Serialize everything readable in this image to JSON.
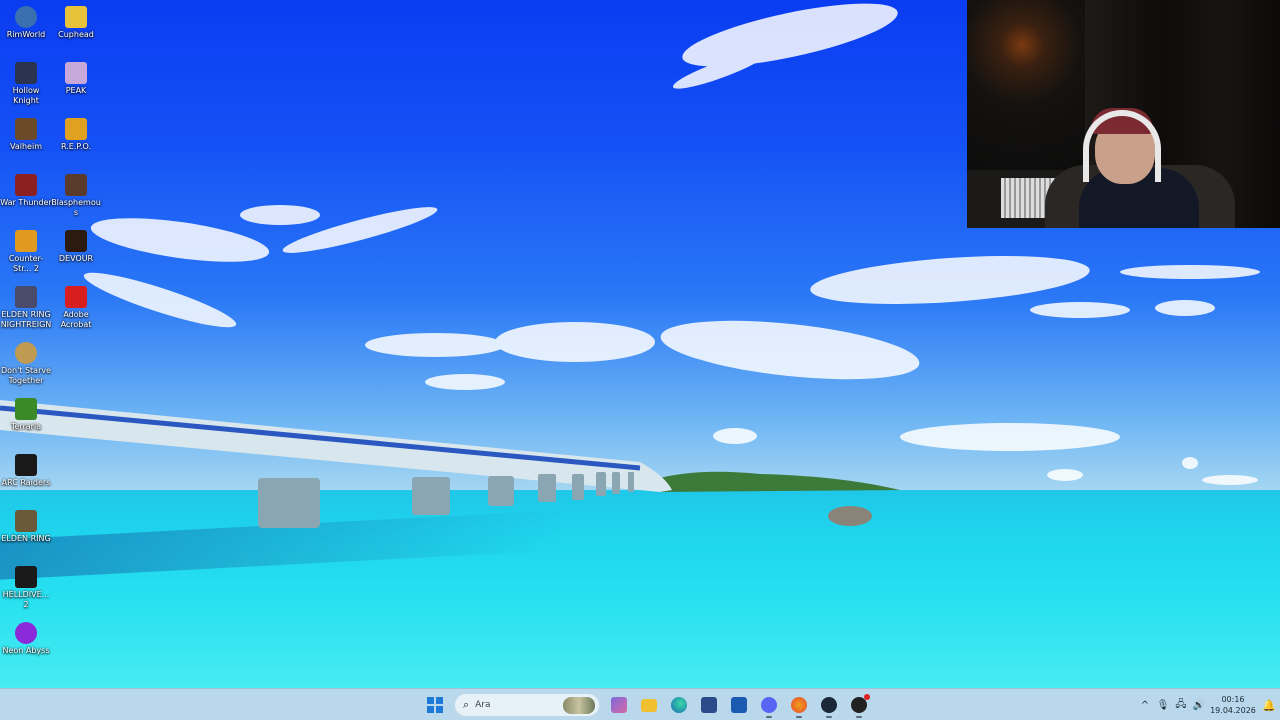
{
  "desktop": {
    "icons": [
      {
        "label": "RimWorld",
        "icon": "rimworld-icon",
        "color": "#3a6fb0"
      },
      {
        "label": "Cuphead",
        "icon": "cuphead-icon",
        "color": "#e8c23a"
      },
      {
        "label": "Hollow Knight",
        "icon": "hollow-knight-icon",
        "color": "#2a3350"
      },
      {
        "label": "PEAK",
        "icon": "peak-icon",
        "color": "#c7a8d8"
      },
      {
        "label": "Valheim",
        "icon": "valheim-icon",
        "color": "#6b4a2a"
      },
      {
        "label": "R.E.P.O.",
        "icon": "repo-icon",
        "color": "#e0a020"
      },
      {
        "label": "War Thunder",
        "icon": "war-thunder-icon",
        "color": "#8a2020"
      },
      {
        "label": "Blasphemous",
        "icon": "blasphemous-icon",
        "color": "#5a3a2a"
      },
      {
        "label": "Counter-Str... 2",
        "icon": "counter-strike-icon",
        "color": "#e09a20"
      },
      {
        "label": "DEVOUR",
        "icon": "devour-icon",
        "color": "#2a1a10"
      },
      {
        "label": "ELDEN RING NIGHTREIGN",
        "icon": "elden-ring-nightreign-icon",
        "color": "#4a4a6a"
      },
      {
        "label": "Adobe Acrobat",
        "icon": "adobe-acrobat-icon",
        "color": "#d81e1e"
      },
      {
        "label": "Don't Starve Together",
        "icon": "dont-starve-icon",
        "color": "#c09a50"
      },
      {
        "label": "Terraria",
        "icon": "terraria-icon",
        "color": "#3a8a2a"
      },
      {
        "label": "ARC Raiders",
        "icon": "arc-raiders-icon",
        "color": "#1a1a1a"
      },
      {
        "label": "ELDEN RING",
        "icon": "elden-ring-icon",
        "color": "#6a5a3a"
      },
      {
        "label": "HELLDIVE... 2",
        "icon": "helldivers-icon",
        "color": "#1a1a1a"
      },
      {
        "label": "Neon Abyss",
        "icon": "neon-abyss-icon",
        "color": "#8a2ad8"
      }
    ]
  },
  "taskbar": {
    "search_placeholder": "Ara",
    "pinned": [
      {
        "name": "start-button",
        "icon": "windows-start-icon",
        "color": "#1e7ad8",
        "active": false
      },
      {
        "name": "widgets-button",
        "icon": "widgets-icon",
        "color": "#7a6ad8",
        "active": false
      },
      {
        "name": "file-explorer-button",
        "icon": "folder-icon",
        "color": "#f0c030",
        "active": false
      },
      {
        "name": "edge-button",
        "icon": "edge-icon",
        "color": "#1a9a8a",
        "active": false
      },
      {
        "name": "store-button",
        "icon": "store-icon",
        "color": "#2a4a8a",
        "active": false
      },
      {
        "name": "outlook-button",
        "icon": "outlook-icon",
        "color": "#1a5ab0",
        "active": false
      },
      {
        "name": "discord-button",
        "icon": "discord-icon",
        "color": "#5865f2",
        "active": true
      },
      {
        "name": "firefox-button",
        "icon": "firefox-icon",
        "color": "#e8662a",
        "active": true
      },
      {
        "name": "steam-button",
        "icon": "steam-icon",
        "color": "#1b2838",
        "active": true
      },
      {
        "name": "obs-button",
        "icon": "obs-icon",
        "color": "#222222",
        "active": true
      }
    ],
    "tray": {
      "chevron": "^",
      "mic": "🎙",
      "network": "🖧",
      "volume": "🔊",
      "time": "00:16",
      "date": "19.04.2026"
    }
  }
}
